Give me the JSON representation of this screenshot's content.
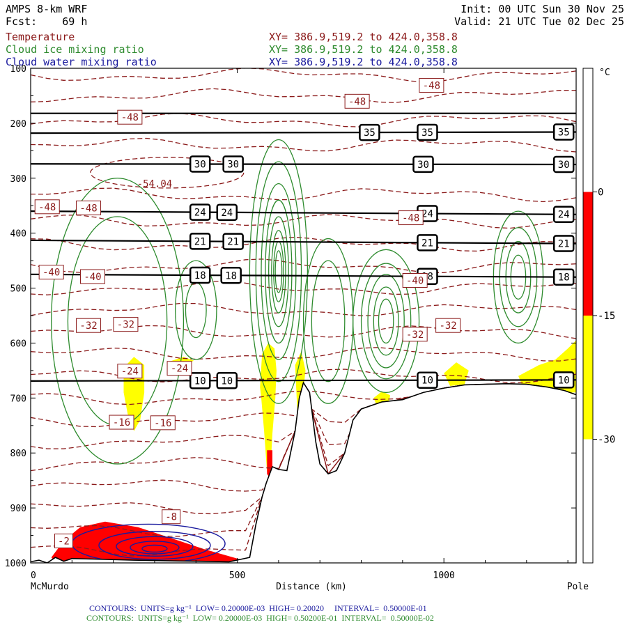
{
  "header": {
    "model": "AMPS 8-km WRF",
    "fcst_label": "Fcst:",
    "fcst_value": "69 h",
    "init": "Init: 00 UTC Sun 30 Nov 25",
    "valid": "Valid: 21 UTC Tue 02 Dec 25"
  },
  "fields": [
    {
      "name": "Temperature",
      "xy": "XY= 386.9,519.2 to 424.0,358.8",
      "color": "#8b1a1a"
    },
    {
      "name": "Cloud ice mixing ratio",
      "xy": "XY= 386.9,519.2 to 424.0,358.8",
      "color": "#2e8b2e"
    },
    {
      "name": "Cloud water mixing ratio",
      "xy": "XY= 386.9,519.2 to 424.0,358.8",
      "color": "#1a1a9e"
    }
  ],
  "footer": {
    "line1": "CONTOURS:  UNITS=g kg⁻¹  LOW= 0.20000E-03  HIGH= 0.20020     INTERVAL=  0.50000E-01",
    "line2": "CONTOURS:  UNITS=g kg⁻¹  LOW= 0.20000E-03  HIGH= 0.50200E-01  INTERVAL=  0.50000E-02",
    "line1_color": "#1a1a9e",
    "line2_color": "#2e8b2e"
  },
  "chart_data": {
    "type": "cross-section",
    "xlabel": "Distance (km)",
    "x_ticks": [
      "0",
      "500",
      "1000"
    ],
    "xlim": [
      0,
      1320
    ],
    "x_endpoints": {
      "left": "McMurdo",
      "right": "Pole"
    },
    "y_ticks": [
      "100",
      "200",
      "300",
      "400",
      "500",
      "600",
      "700",
      "800",
      "900",
      "1000"
    ],
    "ylim": [
      1000,
      100
    ],
    "y_scale": "linear-inverted",
    "colorbar": {
      "unit": "°C",
      "labels": [
        "0",
        "-15",
        "-30"
      ],
      "bands": [
        {
          "from": 15,
          "to": 0,
          "color": "#ffffff"
        },
        {
          "from": 0,
          "to": -15,
          "color": "#ff0000"
        },
        {
          "from": -15,
          "to": -30,
          "color": "#ffff00"
        },
        {
          "from": -30,
          "to": -45,
          "color": "#ffffff"
        }
      ]
    },
    "isotach_lines": [
      {
        "label": "35",
        "p_left": 218,
        "p_right": 216,
        "label_x": [
          820,
          960,
          1290
        ]
      },
      {
        "label": "30",
        "p_left": 274,
        "p_right": 275,
        "label_x": [
          410,
          490,
          950,
          1290
        ]
      },
      {
        "label": "24",
        "p_left": 360,
        "p_right": 366,
        "label_x": [
          410,
          475,
          960,
          1290
        ]
      },
      {
        "label": "21",
        "p_left": 413,
        "p_right": 419,
        "label_x": [
          410,
          490,
          960,
          1290
        ]
      },
      {
        "label": "18",
        "p_left": 475,
        "p_right": 480,
        "label_x": [
          410,
          485,
          960,
          1290
        ]
      },
      {
        "label": "10",
        "p_left": 669,
        "p_right": 667,
        "label_x": [
          410,
          475,
          960,
          1290
        ]
      }
    ],
    "tropopause_line_p": 182,
    "temperature_labels": [
      {
        "text": "-48",
        "x": 970,
        "p": 131
      },
      {
        "text": "-48",
        "x": 790,
        "p": 160
      },
      {
        "text": "-48",
        "x": 240,
        "p": 189
      },
      {
        "text": "-54.04",
        "x": 300,
        "p": 310
      },
      {
        "text": "-48",
        "x": 40,
        "p": 352
      },
      {
        "text": "-48",
        "x": 140,
        "p": 354
      },
      {
        "text": "-48",
        "x": 920,
        "p": 372
      },
      {
        "text": "-40",
        "x": 50,
        "p": 471
      },
      {
        "text": "-40",
        "x": 150,
        "p": 479
      },
      {
        "text": "-40",
        "x": 930,
        "p": 486
      },
      {
        "text": "-32",
        "x": 140,
        "p": 568
      },
      {
        "text": "-32",
        "x": 230,
        "p": 566
      },
      {
        "text": "-32",
        "x": 930,
        "p": 584
      },
      {
        "text": "-32",
        "x": 1010,
        "p": 568
      },
      {
        "text": "-24",
        "x": 240,
        "p": 651
      },
      {
        "text": "-24",
        "x": 360,
        "p": 646
      },
      {
        "text": "-16",
        "x": 220,
        "p": 744
      },
      {
        "text": "-16",
        "x": 320,
        "p": 745
      },
      {
        "text": "-8",
        "x": 340,
        "p": 916
      },
      {
        "text": "-2",
        "x": 80,
        "p": 960
      }
    ],
    "terrain": [
      [
        0,
        998
      ],
      [
        20,
        995
      ],
      [
        40,
        1000
      ],
      [
        60,
        990
      ],
      [
        80,
        997
      ],
      [
        100,
        992
      ],
      [
        150,
        993
      ],
      [
        250,
        995
      ],
      [
        400,
        997
      ],
      [
        480,
        998
      ],
      [
        530,
        990
      ],
      [
        545,
        930
      ],
      [
        560,
        880
      ],
      [
        570,
        855
      ],
      [
        585,
        825
      ],
      [
        600,
        830
      ],
      [
        620,
        832
      ],
      [
        640,
        760
      ],
      [
        650,
        700
      ],
      [
        660,
        672
      ],
      [
        675,
        690
      ],
      [
        690,
        780
      ],
      [
        700,
        820
      ],
      [
        720,
        838
      ],
      [
        740,
        832
      ],
      [
        760,
        800
      ],
      [
        780,
        740
      ],
      [
        800,
        720
      ],
      [
        850,
        707
      ],
      [
        900,
        703
      ],
      [
        950,
        690
      ],
      [
        1000,
        682
      ],
      [
        1050,
        676
      ],
      [
        1100,
        675
      ],
      [
        1150,
        674
      ],
      [
        1200,
        675
      ],
      [
        1250,
        680
      ],
      [
        1290,
        686
      ],
      [
        1320,
        694
      ]
    ]
  }
}
